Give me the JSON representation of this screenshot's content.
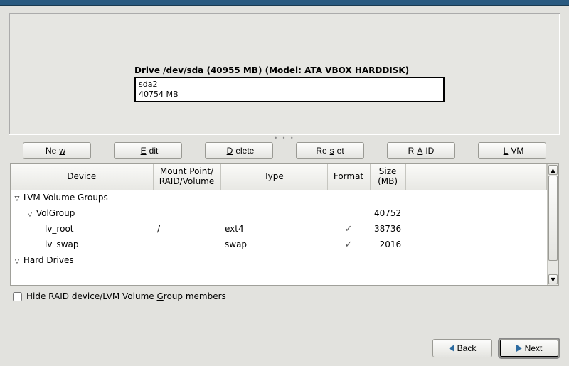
{
  "drive": {
    "title": "Drive /dev/sda (40955 MB) (Model: ATA VBOX HARDDISK)",
    "partition_name": "sda2",
    "partition_size": "40754 MB"
  },
  "toolbar": {
    "new": {
      "pre": "Ne",
      "ul": "w",
      "post": ""
    },
    "edit": {
      "pre": "",
      "ul": "E",
      "post": "dit"
    },
    "delete": {
      "pre": "",
      "ul": "D",
      "post": "elete"
    },
    "reset": {
      "pre": "Re",
      "ul": "s",
      "post": "et"
    },
    "raid": {
      "pre": "R",
      "ul": "A",
      "post": "ID"
    },
    "lvm": {
      "pre": "",
      "ul": "L",
      "post": "VM"
    }
  },
  "columns": {
    "device": "Device",
    "mount": "Mount Point/\nRAID/Volume",
    "type": "Type",
    "format": "Format",
    "size": "Size\n(MB)"
  },
  "tree": {
    "lvm_groups_label": "LVM Volume Groups",
    "volgroup": {
      "name": "VolGroup",
      "size": "40752",
      "lvs": [
        {
          "name": "lv_root",
          "mount": "/",
          "type": "ext4",
          "format": true,
          "size": "38736"
        },
        {
          "name": "lv_swap",
          "mount": "",
          "type": "swap",
          "format": true,
          "size": "2016"
        }
      ]
    },
    "hard_drives_label": "Hard Drives"
  },
  "hide_checkbox": {
    "pre": "Hide RAID device/LVM Volume ",
    "ul": "G",
    "post": "roup members",
    "checked": false
  },
  "nav": {
    "back": {
      "ul": "B",
      "post": "ack"
    },
    "next": {
      "ul": "N",
      "post": "ext"
    }
  }
}
